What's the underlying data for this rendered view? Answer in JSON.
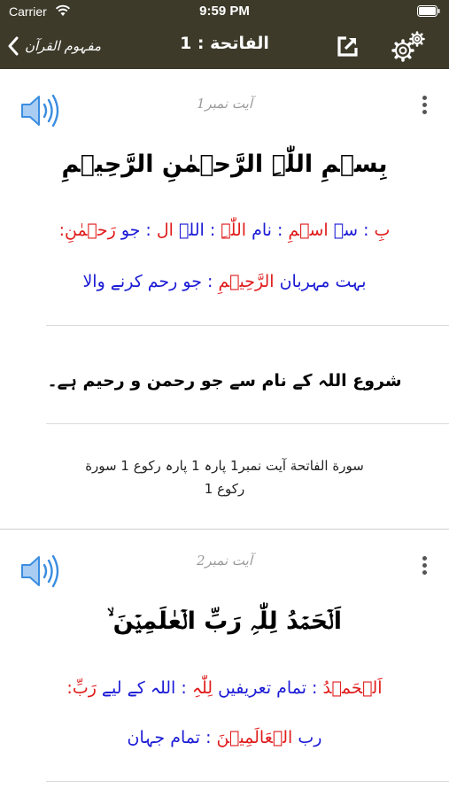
{
  "status_bar": {
    "carrier": "Carrier",
    "time": "9:59 PM",
    "icons": [
      "wifi-icon",
      "battery-icon"
    ]
  },
  "nav": {
    "back_label": "مفہوم القرآن",
    "title": "الفاتحة : 1",
    "icons": [
      "chevron-left-icon",
      "share-icon",
      "gear-icon"
    ]
  },
  "colors": {
    "nav_background": "#3d3a2a",
    "word_red": "#e01b1b",
    "word_blue": "#1a1ad6",
    "speaker": "#3b8de0"
  },
  "verses": [
    {
      "ayat_label": "آیت نمبر1",
      "arabic": "بِسۡمِ اللّٰہِ الرَّحۡمٰنِ الرَّحِیۡمِ",
      "words_line1": [
        {
          "text": "بِ",
          "color": "red"
        },
        {
          "text": ": سے",
          "color": "blue"
        },
        {
          "text": "اسۡمِ",
          "color": "red"
        },
        {
          "text": ": نام",
          "color": "blue"
        },
        {
          "text": "اللّٰہِ",
          "color": "red"
        },
        {
          "text": ": اللہ",
          "color": "blue"
        },
        {
          "text": "ال",
          "color": "red"
        },
        {
          "text": ": جو",
          "color": "blue"
        },
        {
          "text": "رَحۡمٰنِ",
          "color": "red"
        },
        {
          "text": ":",
          "color": "red"
        }
      ],
      "words_line2": [
        {
          "text": "بہت مہربان",
          "color": "blue"
        },
        {
          "text": "الرَّحِیۡمِ",
          "color": "red"
        },
        {
          "text": ": جو رحم کرنے والا",
          "color": "blue"
        }
      ],
      "translation": "شروع اللہ کے نام سے جو رحمن و رحیم ہے۔",
      "reference_line1": "سورة الفاتحة آیت نمبر1  پارہ 1 پارہ رکوع 1 سورة",
      "reference_line2": "رکوع 1"
    },
    {
      "ayat_label": "آیت نمبر2",
      "arabic": "اَلۡحَمۡدُ لِلّٰہِ رَبِّ الۡعٰلَمِیۡنَ ۙ",
      "words_line1": [
        {
          "text": "اَلۡحَمۡدُ",
          "color": "red"
        },
        {
          "text": ": تمام تعریفیں",
          "color": "blue"
        },
        {
          "text": "لِلّٰہِ",
          "color": "red"
        },
        {
          "text": ": اللہ کے لیے",
          "color": "blue"
        },
        {
          "text": "رَبِّ",
          "color": "red"
        },
        {
          "text": ":",
          "color": "red"
        }
      ],
      "words_line2": [
        {
          "text": "رب",
          "color": "blue"
        },
        {
          "text": "الۡعَالَمِیۡنَ",
          "color": "red"
        },
        {
          "text": ": تمام جہان",
          "color": "blue"
        }
      ]
    }
  ]
}
